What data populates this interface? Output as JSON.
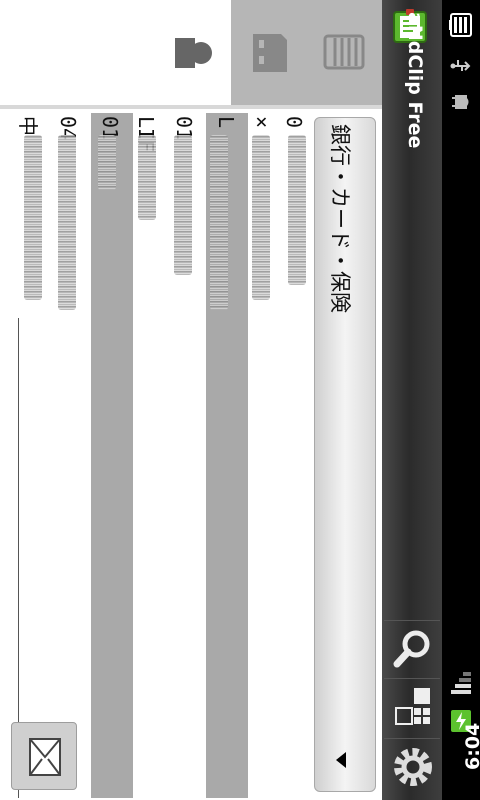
{
  "status_bar": {
    "time": "6:04",
    "icons": [
      "battery-icon",
      "usb-icon",
      "debug-android-icon",
      "signal-icon",
      "charging-icon"
    ]
  },
  "action_bar": {
    "app_title": "aNdClip Free",
    "buttons": [
      "search-icon",
      "widgets-icon",
      "settings-icon"
    ]
  },
  "spinner": {
    "selected": "銀行・カード・保険"
  },
  "tabs": [
    {
      "name": "contacts",
      "icon": "person-icon",
      "active": true
    },
    {
      "name": "sd-card",
      "icon": "sdcard-icon",
      "active": false
    },
    {
      "name": "list",
      "icon": "list-icon",
      "active": false
    }
  ],
  "list": {
    "rows": [
      {
        "text": "0",
        "selected": false
      },
      {
        "text": "×",
        "selected": false
      },
      {
        "text": "L",
        "selected": true
      },
      {
        "text": "01",
        "selected": false
      },
      {
        "text": "LIF",
        "selected": false
      },
      {
        "text": "01",
        "selected": true
      },
      {
        "text": "04",
        "selected": false
      },
      {
        "text": "中",
        "selected": false
      }
    ]
  },
  "colors": {
    "selected_row": "#a9a9a9",
    "action_bar": "#333333",
    "status_bar": "#000000"
  }
}
